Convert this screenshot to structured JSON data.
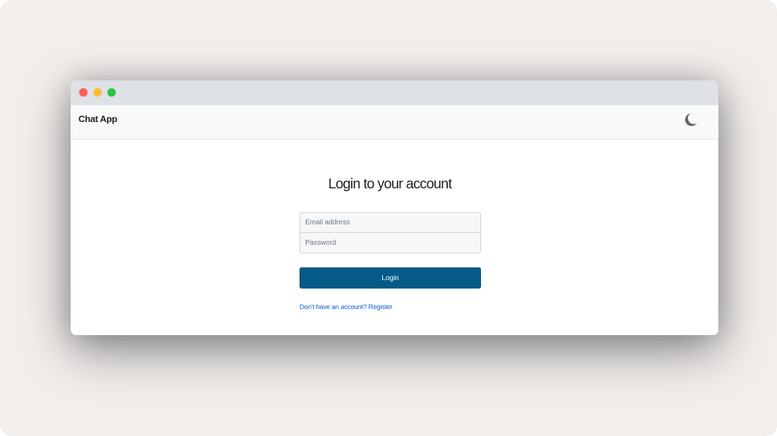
{
  "window": {
    "traffic_lights": [
      "close",
      "minimize",
      "maximize"
    ]
  },
  "navbar": {
    "brand": "Chat App",
    "theme_toggle_icon": "moon-icon"
  },
  "login": {
    "heading": "Login to your account",
    "email_placeholder": "Email address",
    "email_value": "",
    "password_placeholder": "Password",
    "password_value": "",
    "submit_label": "Login",
    "register_link": "Don't have an account? Register"
  },
  "colors": {
    "primary_button": "#065a87",
    "link": "#0b5ed7",
    "navbar_bg": "#f8f9fa",
    "titlebar_bg": "#dee1e6",
    "close": "#ff5f57",
    "minimize": "#febc2e",
    "maximize": "#28c840",
    "moon": "#5f6470"
  }
}
